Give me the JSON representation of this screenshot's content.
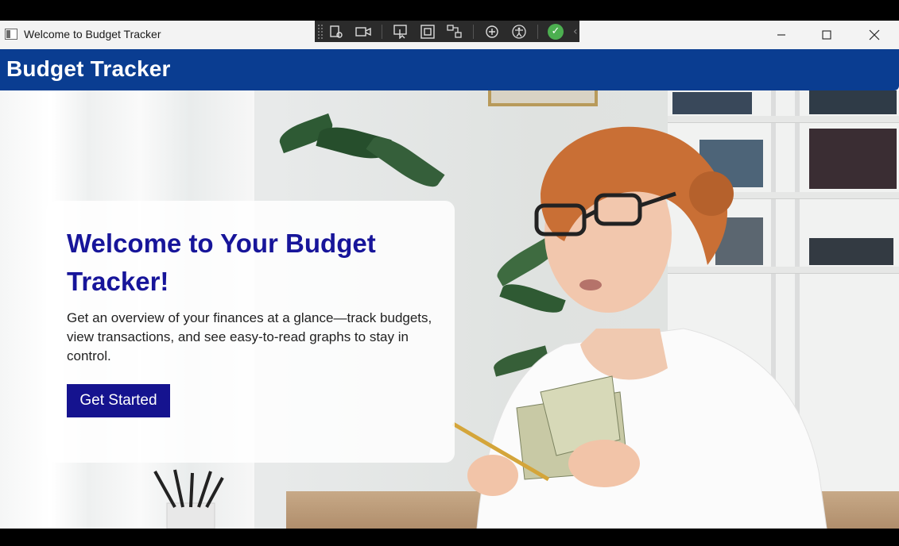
{
  "window": {
    "title": "Welcome to Budget Tracker",
    "icon": "app-window-icon",
    "controls": {
      "minimize": "—",
      "maximize": "☐",
      "close": "✕"
    }
  },
  "debug_toolbar": {
    "icons": [
      "live-visual-tree-icon",
      "record-icon",
      "select-element-icon",
      "display-layout-icon",
      "track-focus-icon",
      "hot-reload-icon",
      "accessibility-icon",
      "check-icon",
      "chevron-left-icon"
    ]
  },
  "header": {
    "title": "Budget Tracker",
    "background": "#0a3d91"
  },
  "hero": {
    "heading": "Welcome to Your Budget Tracker!",
    "description": "Get an overview of your finances at a glance—track budgets, view transactions, and see easy-to-read graphs to stay in control.",
    "cta_label": "Get Started",
    "heading_color": "#17159a",
    "cta_color": "#15138f"
  }
}
